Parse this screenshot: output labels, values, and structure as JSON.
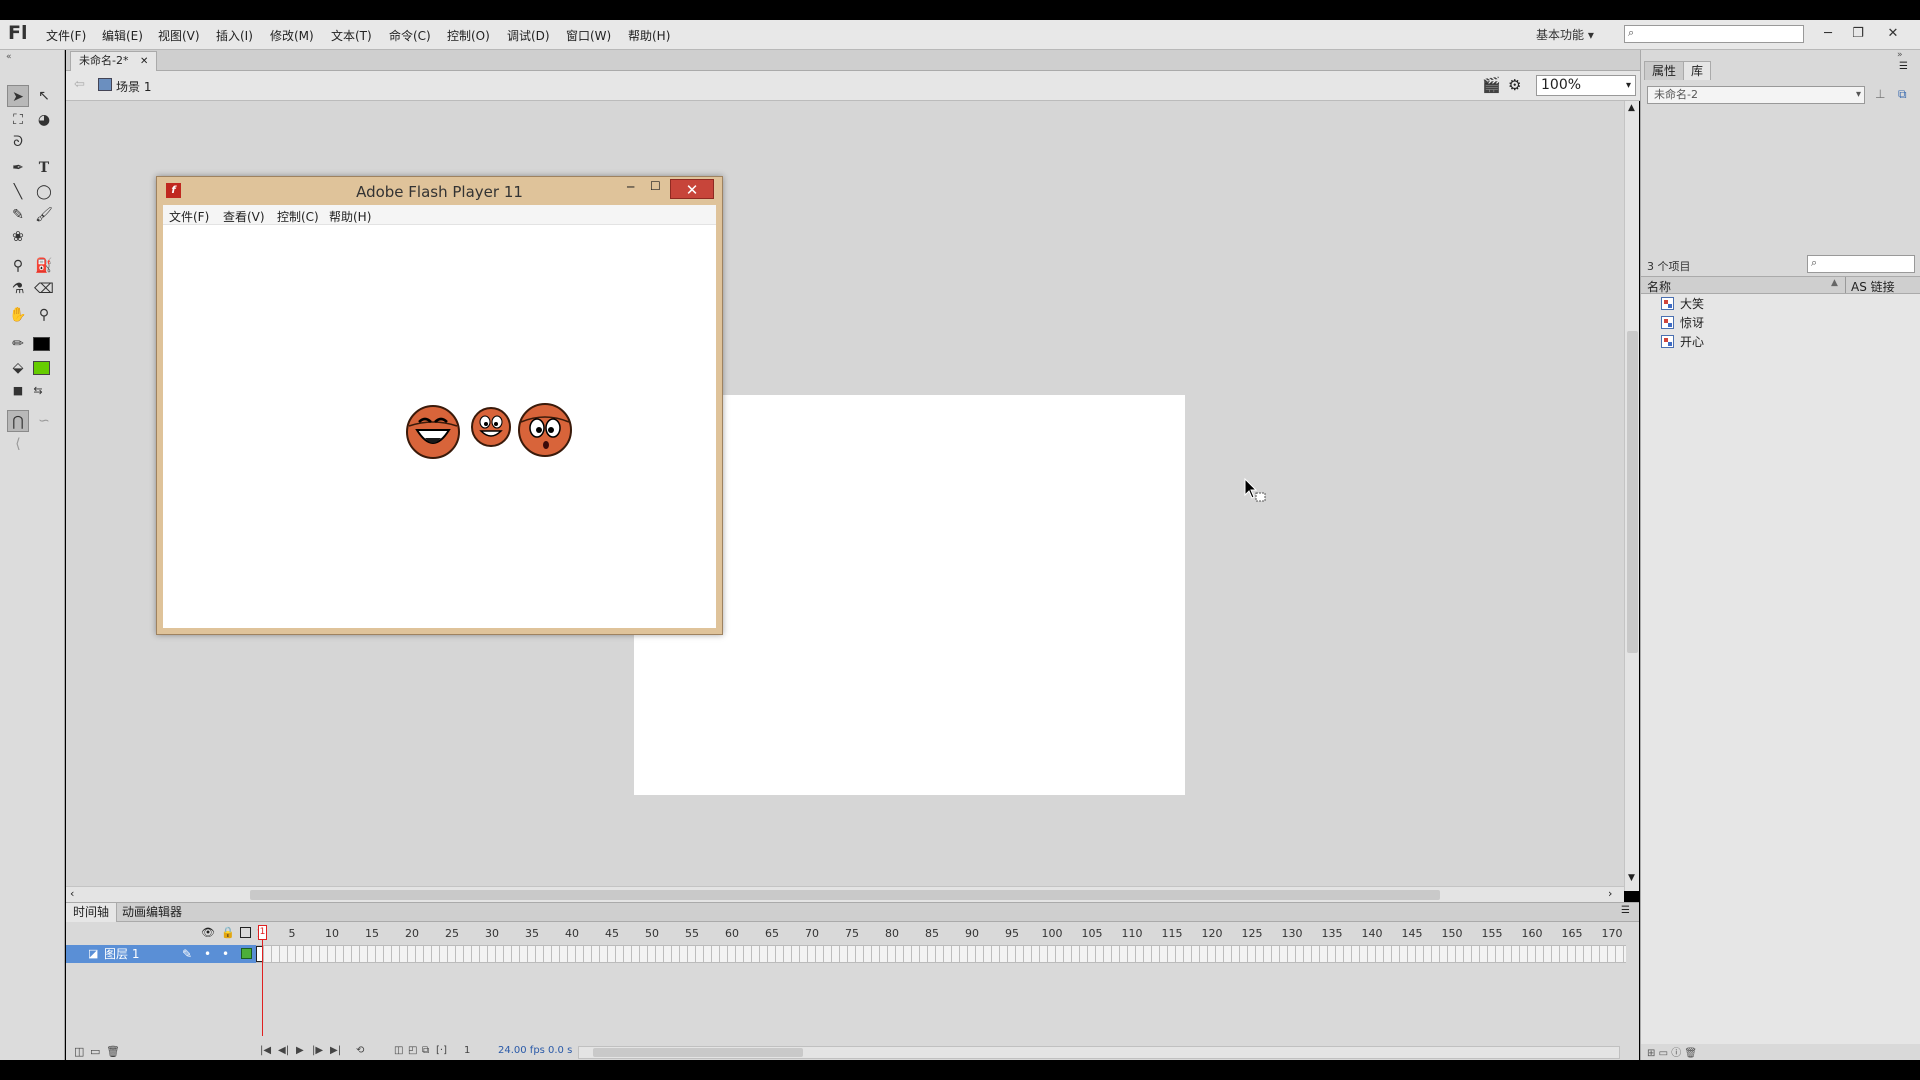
{
  "app": {
    "logo": "Fl",
    "menu": [
      "文件(F)",
      "编辑(E)",
      "视图(V)",
      "插入(I)",
      "修改(M)",
      "文本(T)",
      "命令(C)",
      "控制(O)",
      "调试(D)",
      "窗口(W)",
      "帮助(H)"
    ],
    "workspace": "基本功能"
  },
  "document": {
    "tab": "未命名-2*",
    "scene": "场景 1",
    "zoom": "100%"
  },
  "flash_player": {
    "title": "Adobe Flash Player 11",
    "menu": [
      "文件(F)",
      "查看(V)",
      "控制(C)",
      "帮助(H)"
    ]
  },
  "panel": {
    "tabs": [
      "属性",
      "库"
    ],
    "library_select": "未命名-2",
    "item_count": "3 个项目",
    "columns": {
      "name": "名称",
      "linkage": "AS 链接"
    },
    "items": [
      "大笑",
      "惊讶",
      "开心"
    ]
  },
  "timeline": {
    "tabs": [
      "时间轴",
      "动画编辑器"
    ],
    "ruler": [
      "1",
      "5",
      "10",
      "15",
      "20",
      "25",
      "30",
      "35",
      "40",
      "45",
      "50",
      "55",
      "60",
      "65",
      "70",
      "75",
      "80",
      "85",
      "90",
      "95",
      "100",
      "105",
      "110",
      "115",
      "120",
      "125",
      "130",
      "135",
      "140",
      "145",
      "150",
      "155",
      "160",
      "165",
      "170"
    ],
    "layer": "图层 1",
    "current_frame": "1",
    "fps": "24.00 fps",
    "time": "0.0 s"
  },
  "colors": {
    "stroke": "#000000",
    "fill": "#66cc00",
    "selected_layer": "#5a8fd6",
    "playhead": "#e02020"
  }
}
